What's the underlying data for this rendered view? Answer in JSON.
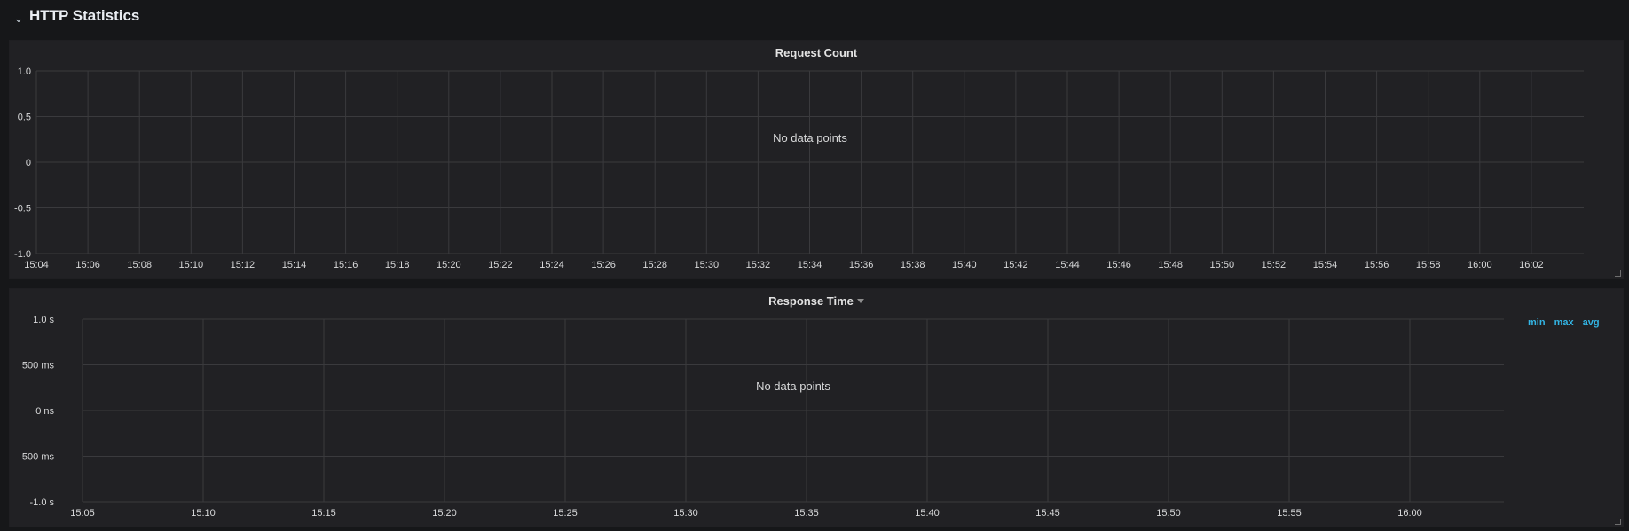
{
  "row": {
    "title": "HTTP Statistics",
    "chevron_icon": "chevron-down-icon"
  },
  "panels": [
    {
      "title": "Request Count",
      "no_data": "No data points",
      "chart_data": {
        "type": "line",
        "title": "Request Count",
        "series": [],
        "yticks": [
          "1.0",
          "0.5",
          "0",
          "-0.5",
          "-1.0"
        ],
        "ylim": [
          -1.0,
          1.0
        ],
        "xticks": [
          "15:04",
          "15:06",
          "15:08",
          "15:10",
          "15:12",
          "15:14",
          "15:16",
          "15:18",
          "15:20",
          "15:22",
          "15:24",
          "15:26",
          "15:28",
          "15:30",
          "15:32",
          "15:34",
          "15:36",
          "15:38",
          "15:40",
          "15:42",
          "15:44",
          "15:46",
          "15:48",
          "15:50",
          "15:52",
          "15:54",
          "15:56",
          "15:58",
          "16:00",
          "16:02"
        ],
        "grid": true
      }
    },
    {
      "title": "Response Time",
      "no_data": "No data points",
      "legend": [
        "min",
        "max",
        "avg"
      ],
      "chart_data": {
        "type": "line",
        "title": "Response Time",
        "series": [],
        "yticks": [
          "1.0 s",
          "500 ms",
          "0 ns",
          "-500 ms",
          "-1.0 s"
        ],
        "ylim": [
          -1.0,
          1.0
        ],
        "xticks": [
          "15:05",
          "15:10",
          "15:15",
          "15:20",
          "15:25",
          "15:30",
          "15:35",
          "15:40",
          "15:45",
          "15:50",
          "15:55",
          "16:00"
        ],
        "grid": true
      }
    }
  ],
  "colors": {
    "background": "#161719",
    "panel": "#212124",
    "grid": "#3a3a3d",
    "legend": "#33b5e5"
  }
}
